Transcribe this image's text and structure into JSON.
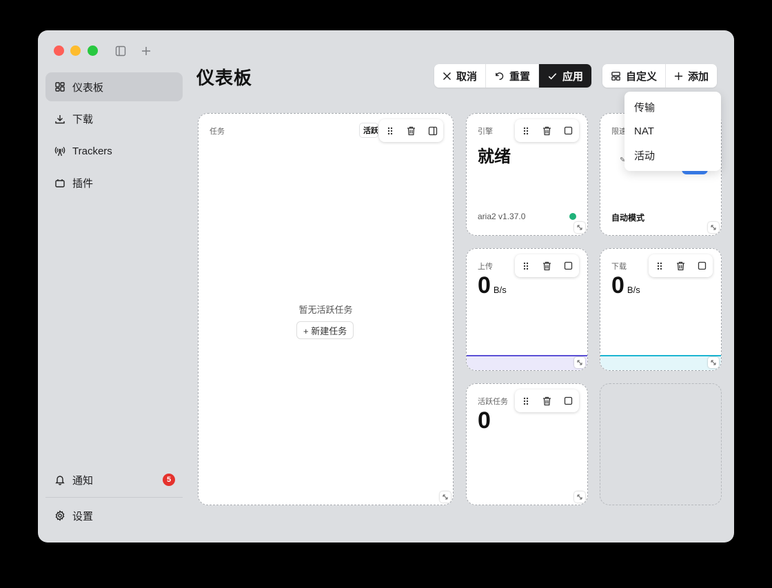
{
  "window": {
    "colors": {
      "red": "#fe5f57",
      "yellow": "#febc2e",
      "green": "#28c840"
    }
  },
  "titlebar": {
    "icons": [
      "sidebar-toggle-icon",
      "plus-icon"
    ]
  },
  "sidebar": {
    "items": [
      {
        "label": "仪表板",
        "icon": "dashboard-icon",
        "active": true
      },
      {
        "label": "下载",
        "icon": "download-icon",
        "active": false
      },
      {
        "label": "Trackers",
        "icon": "antenna-icon",
        "active": false
      },
      {
        "label": "插件",
        "icon": "plugin-icon",
        "active": false
      }
    ],
    "notifications": {
      "label": "通知",
      "count": "5",
      "icon": "bell-icon"
    },
    "settings": {
      "label": "设置",
      "icon": "gear-icon"
    }
  },
  "header": {
    "title": "仪表板",
    "cancel_label": "取消",
    "reset_label": "重置",
    "apply_label": "应用",
    "customize_label": "自定义",
    "add_label": "添加"
  },
  "add_menu": {
    "items": [
      "传输",
      "NAT",
      "活动"
    ]
  },
  "widgets": {
    "tasks": {
      "label": "任务",
      "tab": "活跃",
      "empty_text": "暂无活跃任务",
      "new_task_label": "+ 新建任务"
    },
    "engine": {
      "label": "引擎",
      "state": "就绪",
      "version": "aria2 v1.37.0",
      "status_color": "#1fb27a"
    },
    "speed_limit": {
      "label": "限速",
      "mode": "自动模式"
    },
    "upload": {
      "label": "上传",
      "value": "0",
      "unit": "B/s",
      "color": "#5b50d6"
    },
    "download": {
      "label": "下载",
      "value": "0",
      "unit": "B/s",
      "color": "#1cb5d2"
    },
    "active_tasks": {
      "label": "活跃任务",
      "value": "0"
    }
  },
  "colors": {
    "accent_dark": "#1c1c1e",
    "badge": "#e5322d",
    "window_bg": "#dcdee1"
  }
}
